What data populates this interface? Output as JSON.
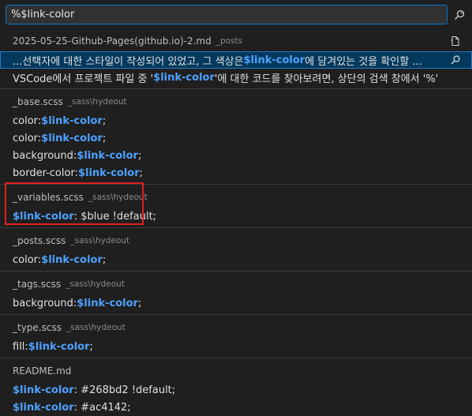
{
  "search": {
    "value": "%$link-color"
  },
  "icons": {
    "search": "find-replace-icon",
    "open_file": "open-file-icon",
    "replace": "replace-icon"
  },
  "colors": {
    "highlight": "#4ea1ff",
    "selection": "#04395e",
    "focus_border": "#0078d4",
    "annotation_box": "#e02020"
  },
  "groups": [
    {
      "file": "2025-05-25-Github-Pages(github.io)-2.md",
      "path": "_posts",
      "rows": [
        [
          "...선택자에 대한 스타일이 작성되어 있었고, 그 색상은 ",
          {
            "hl": "$link-color"
          },
          "에 담겨있는 것을 확인할 ..."
        ],
        [
          "VSCode에서 프로젝트 파일 중 '",
          {
            "hl": "$link-color"
          },
          "'에 대한 코드를 찾아보려면, 상단의 검색 창에서 '%'"
        ]
      ]
    },
    {
      "file": "_base.scss",
      "path": "_sass\\hydeout",
      "rows": [
        [
          "color: ",
          {
            "hl": "$link-color"
          },
          ";"
        ],
        [
          "color: ",
          {
            "hl": "$link-color"
          },
          ";"
        ],
        [
          "background: ",
          {
            "hl": "$link-color"
          },
          ";"
        ],
        [
          "border-color: ",
          {
            "hl": "$link-color"
          },
          ";"
        ]
      ]
    },
    {
      "file": "_variables.scss",
      "path": "_sass\\hydeout",
      "rows": [
        [
          {
            "hl": "$link-color"
          },
          ": $blue !default;"
        ]
      ]
    },
    {
      "file": "_posts.scss",
      "path": "_sass\\hydeout",
      "rows": [
        [
          "color: ",
          {
            "hl": "$link-color"
          },
          ";"
        ]
      ]
    },
    {
      "file": "_tags.scss",
      "path": "_sass\\hydeout",
      "rows": [
        [
          "background: ",
          {
            "hl": "$link-color"
          },
          ";"
        ]
      ]
    },
    {
      "file": "_type.scss",
      "path": "_sass\\hydeout",
      "rows": [
        [
          "fill: ",
          {
            "hl": "$link-color"
          },
          ";"
        ]
      ]
    },
    {
      "file": "README.md",
      "path": "",
      "rows": [
        [
          {
            "hl": "$link-color"
          },
          ": #268bd2 !default;"
        ],
        [
          {
            "hl": "$link-color"
          },
          ": #ac4142;"
        ]
      ]
    }
  ]
}
